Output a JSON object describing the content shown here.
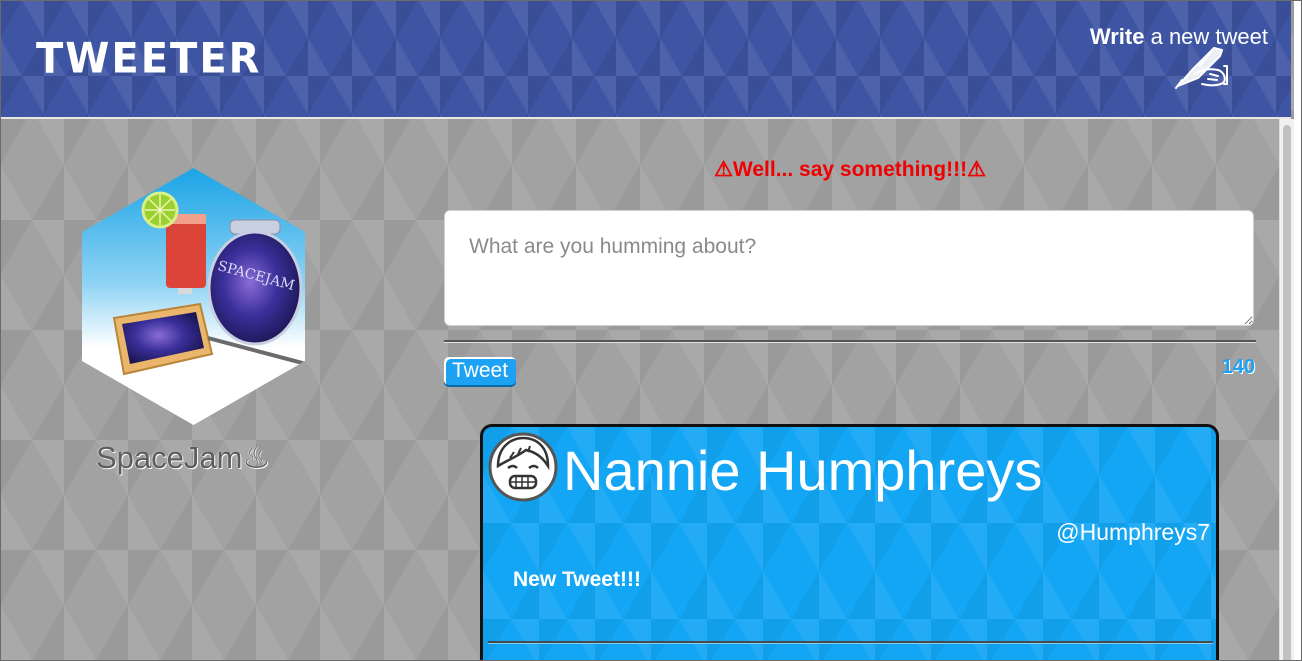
{
  "header": {
    "brand": "TWEETER",
    "compose_bold": "Write",
    "compose_rest": " a new tweet",
    "compose_icon": "quill-hand-icon"
  },
  "profile": {
    "username": "SpaceJam♨",
    "avatar": "space-jam-toast-avatar"
  },
  "compose": {
    "error": "⚠Well... say something!!!⚠",
    "placeholder": "What are you humming about?",
    "value": "",
    "submit_label": "Tweet",
    "counter": "140"
  },
  "tweets": [
    {
      "name": "Nannie Humphreys",
      "handle": "@Humphreys7",
      "body": "New Tweet!!!",
      "avatar": "smiling-face-avatar"
    }
  ],
  "colors": {
    "header_bg": "#3e55a4",
    "error": "#f00000",
    "accent": "#1da1f2",
    "card_bg": "#12a6f4"
  }
}
